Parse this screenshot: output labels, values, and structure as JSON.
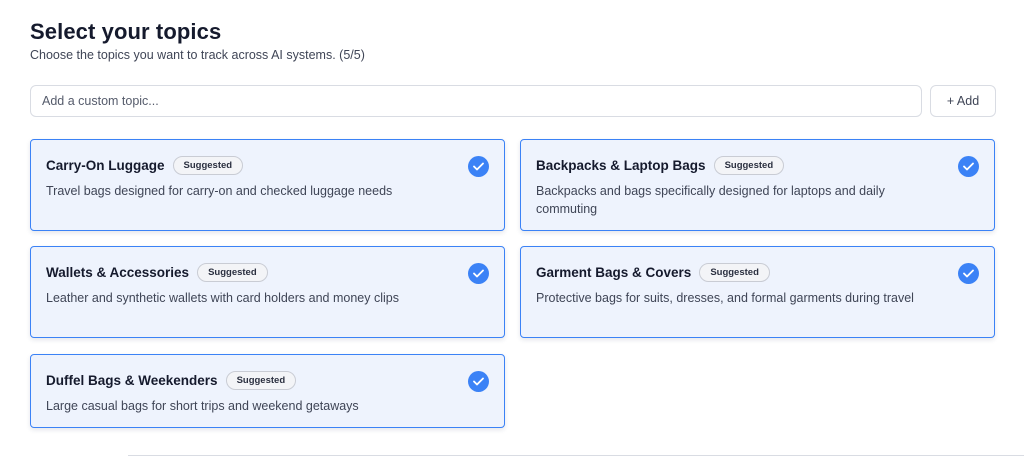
{
  "header": {
    "title": "Select your topics",
    "subtitle": "Choose the topics you want to track across AI systems. (5/5)"
  },
  "custom_topic": {
    "placeholder": "Add a custom topic...",
    "value": "",
    "add_label": "+ Add"
  },
  "accent_color": "#3b82f6",
  "topics": [
    {
      "title": "Carry-On Luggage",
      "badge": "Suggested",
      "description": "Travel bags designed for carry-on and checked luggage needs",
      "selected": true
    },
    {
      "title": "Backpacks & Laptop Bags",
      "badge": "Suggested",
      "description": "Backpacks and bags specifically designed for laptops and daily commuting",
      "selected": true
    },
    {
      "title": "Wallets & Accessories",
      "badge": "Suggested",
      "description": "Leather and synthetic wallets with card holders and money clips",
      "selected": true
    },
    {
      "title": "Garment Bags & Covers",
      "badge": "Suggested",
      "description": "Protective bags for suits, dresses, and formal garments during travel",
      "selected": true
    },
    {
      "title": "Duffel Bags & Weekenders",
      "badge": "Suggested",
      "description": "Large casual bags for short trips and weekend getaways",
      "selected": true
    }
  ]
}
